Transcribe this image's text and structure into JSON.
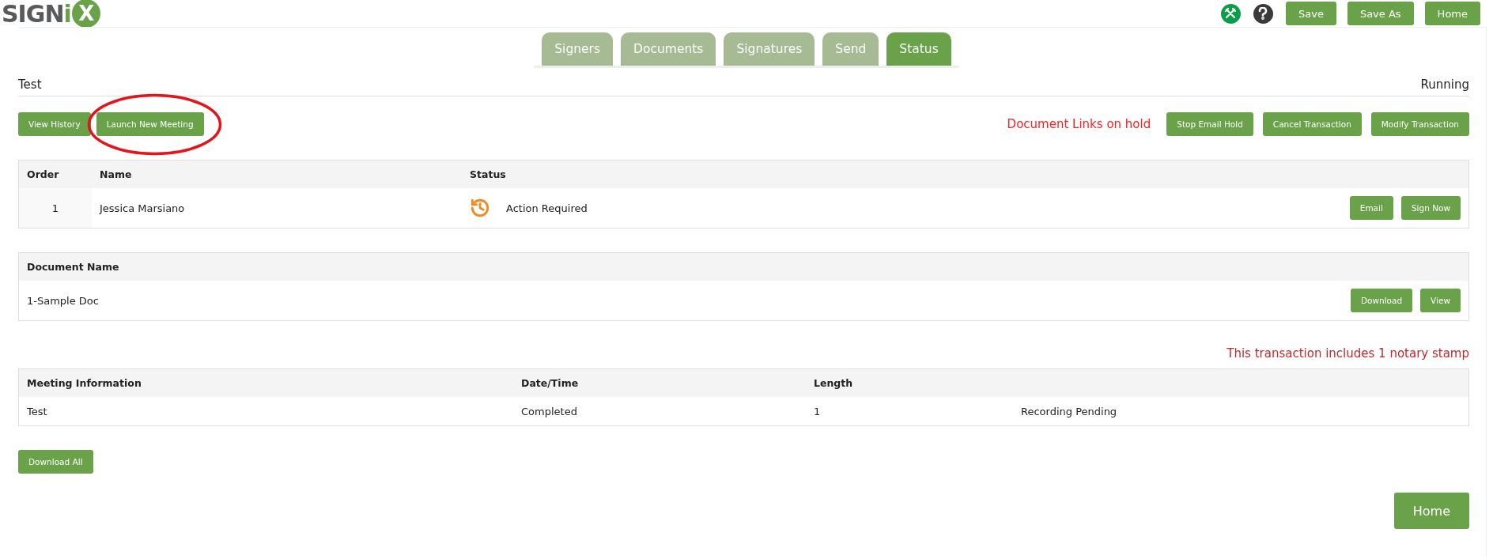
{
  "logo": {
    "word": "SIGN",
    "letter": "i",
    "badge": "X"
  },
  "toolbar": {
    "buttons": [
      "Save",
      "Save As",
      "Home"
    ]
  },
  "tabs": [
    {
      "label": "Signers",
      "selected": false
    },
    {
      "label": "Documents",
      "selected": false
    },
    {
      "label": "Signatures",
      "selected": false
    },
    {
      "label": "Send",
      "selected": false
    },
    {
      "label": "Status",
      "selected": true
    }
  ],
  "transaction": {
    "title": "Test",
    "status": "Running"
  },
  "actions_left": [
    "View History",
    "Launch New Meeting"
  ],
  "hold_notice": "Document Links on hold",
  "actions_right": [
    "Stop Email Hold",
    "Cancel Transaction",
    "Modify Transaction"
  ],
  "signers": {
    "columns": [
      "Order",
      "Name",
      "Status"
    ],
    "rows": [
      {
        "order": "1",
        "name": "Jessica Marsiano",
        "status": "Action Required",
        "actions": [
          "Email",
          "Sign Now"
        ]
      }
    ]
  },
  "documents": {
    "columns": [
      "Document Name"
    ],
    "rows": [
      {
        "name": "1-Sample Doc",
        "actions": [
          "Download",
          "View"
        ]
      }
    ]
  },
  "notary_notice": "This transaction includes 1 notary stamp",
  "meetings": {
    "columns": [
      "Meeting Information",
      "Date/Time",
      "Length"
    ],
    "rows": [
      {
        "cells": [
          "Test",
          "Completed",
          "1",
          "Recording Pending"
        ]
      }
    ]
  },
  "download_all": "Download All",
  "home_button": "Home"
}
